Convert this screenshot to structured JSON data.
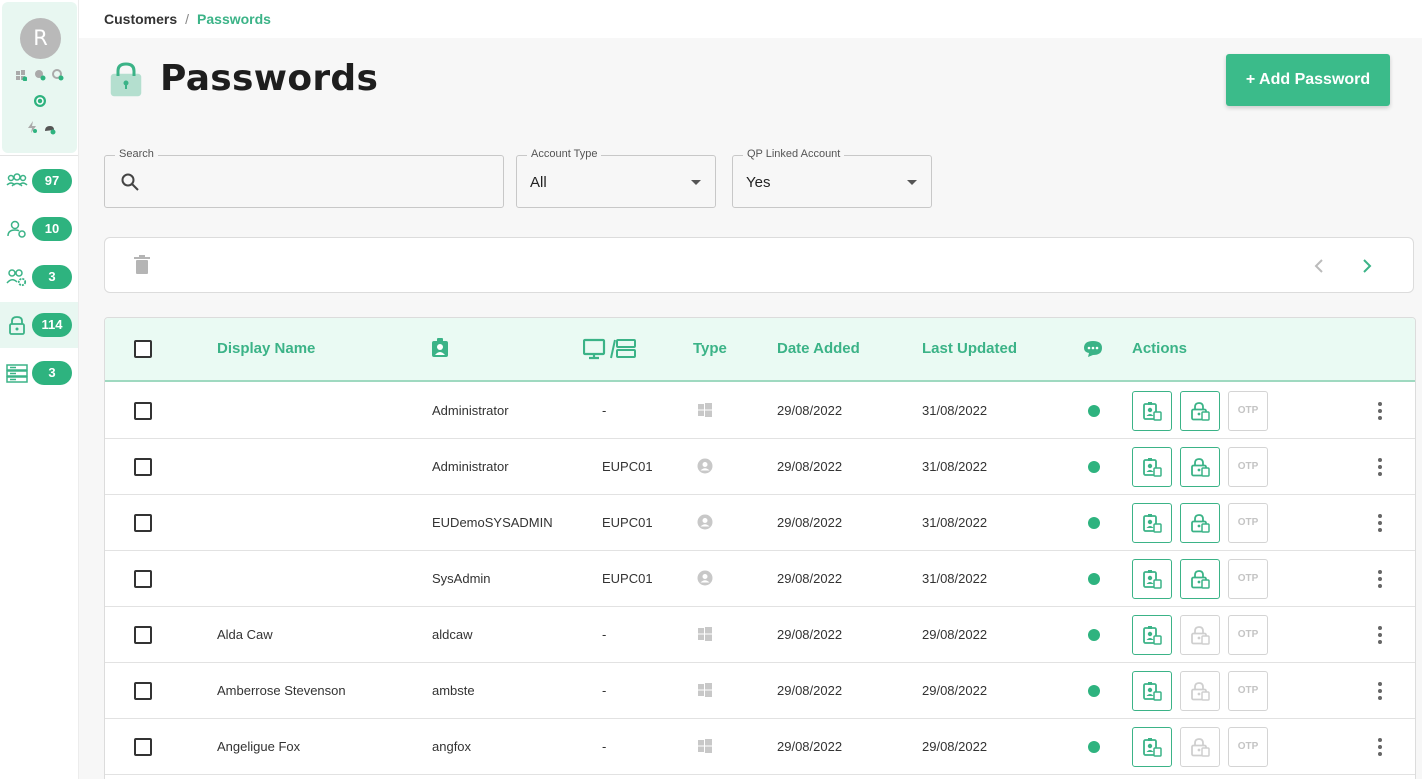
{
  "sidebar": {
    "avatar_initial": "R",
    "items": [
      {
        "icon": "users-group-icon",
        "count": "97"
      },
      {
        "icon": "user-settings-icon",
        "count": "10"
      },
      {
        "icon": "users-gear-icon",
        "count": "3"
      },
      {
        "icon": "lock-icon",
        "count": "114",
        "active": true
      },
      {
        "icon": "servers-icon",
        "count": "3"
      }
    ]
  },
  "breadcrumb": {
    "parent": "Customers",
    "separator": "/",
    "current": "Passwords"
  },
  "page": {
    "title": "Passwords",
    "add_button": "+ Add Password"
  },
  "filters": {
    "search": {
      "label": "Search",
      "placeholder": "",
      "value": ""
    },
    "account_type": {
      "label": "Account Type",
      "value": "All"
    },
    "qp_linked": {
      "label": "QP Linked Account",
      "value": "Yes"
    }
  },
  "table": {
    "headers": {
      "display_name": "Display Name",
      "type": "Type",
      "date_added": "Date Added",
      "last_updated": "Last Updated",
      "actions": "Actions"
    },
    "otp_label": "OTP",
    "rows": [
      {
        "display_name": "",
        "username": "Administrator",
        "device": "-",
        "type": "windows",
        "date_added": "29/08/2022",
        "last_updated": "31/08/2022",
        "second_action_enabled": true
      },
      {
        "display_name": "",
        "username": "Administrator",
        "device": "EUPC01",
        "type": "user",
        "date_added": "29/08/2022",
        "last_updated": "31/08/2022",
        "second_action_enabled": true
      },
      {
        "display_name": "",
        "username": "EUDemoSYSADMIN",
        "device": "EUPC01",
        "type": "user",
        "date_added": "29/08/2022",
        "last_updated": "31/08/2022",
        "second_action_enabled": true
      },
      {
        "display_name": "",
        "username": "SysAdmin",
        "device": "EUPC01",
        "type": "user",
        "date_added": "29/08/2022",
        "last_updated": "31/08/2022",
        "second_action_enabled": true
      },
      {
        "display_name": "Alda Caw",
        "username": "aldcaw",
        "device": "-",
        "type": "windows",
        "date_added": "29/08/2022",
        "last_updated": "29/08/2022",
        "second_action_enabled": false
      },
      {
        "display_name": "Amberrose Stevenson",
        "username": "ambste",
        "device": "-",
        "type": "windows",
        "date_added": "29/08/2022",
        "last_updated": "29/08/2022",
        "second_action_enabled": false
      },
      {
        "display_name": "Angeligue Fox",
        "username": "angfox",
        "device": "-",
        "type": "windows",
        "date_added": "29/08/2022",
        "last_updated": "29/08/2022",
        "second_action_enabled": false
      }
    ]
  },
  "colors": {
    "accent": "#3bb387",
    "badge": "#2eb37f",
    "header_bg": "#eafaf3"
  }
}
